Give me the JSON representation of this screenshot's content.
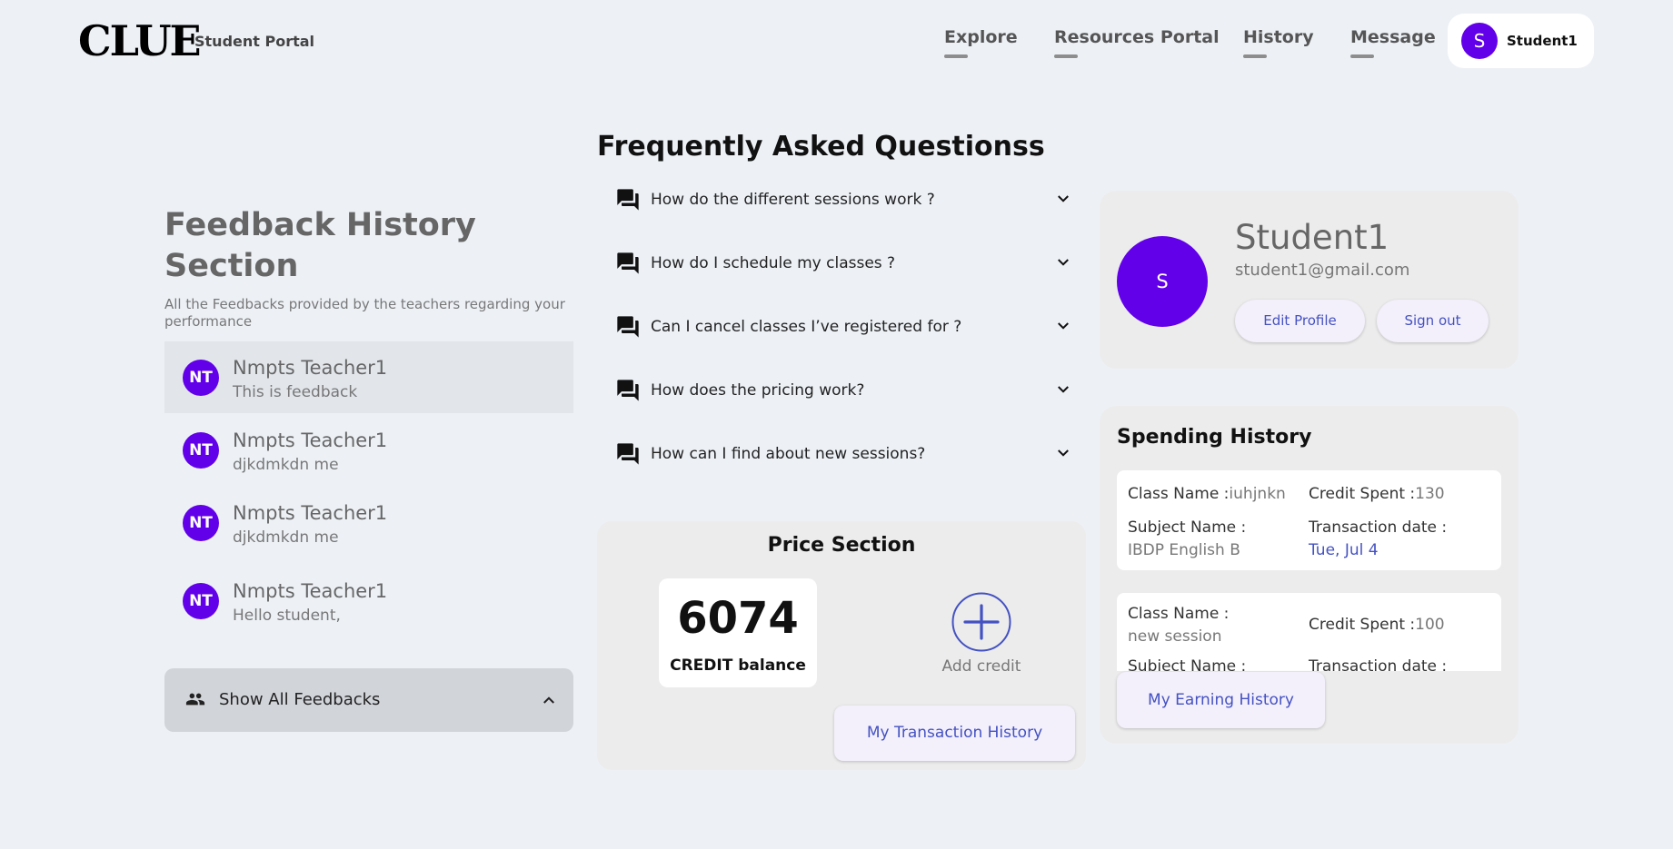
{
  "header": {
    "logo": "CLUE",
    "logo_sub": "Student Portal",
    "nav": [
      {
        "label": "Explore"
      },
      {
        "label": "Resources Portal"
      },
      {
        "label": "History"
      },
      {
        "label": "Message"
      }
    ],
    "user": {
      "initial": "S",
      "name": "Student1"
    }
  },
  "feedback": {
    "title": "Feedback History Section",
    "description": "All the Feedbacks provided by the teachers regarding your performance",
    "items": [
      {
        "initials": "NT",
        "name": "Nmpts Teacher1",
        "text": "This is feedback",
        "active": true
      },
      {
        "initials": "NT",
        "name": "Nmpts Teacher1",
        "text": "djkdmkdn me",
        "active": false
      },
      {
        "initials": "NT",
        "name": "Nmpts Teacher1",
        "text": "djkdmkdn me",
        "active": false
      },
      {
        "initials": "NT",
        "name": "Nmpts Teacher1",
        "text": "Hello student,",
        "active": false
      }
    ],
    "show_all_label": "Show All Feedbacks"
  },
  "faq": {
    "title": "Frequently Asked Questionss",
    "questions": [
      "How do the different sessions work ?",
      "How do I schedule my classes ?",
      "Can I cancel classes I’ve registered for ?",
      "How does the pricing work?",
      "How can I find about new sessions?"
    ]
  },
  "price": {
    "title": "Price Section",
    "balance": "6074",
    "balance_label": "CREDIT balance",
    "add_label": "Add credit",
    "transaction_button": "My Transaction History"
  },
  "profile": {
    "initial": "S",
    "name": "Student1",
    "email": "student1@gmail.com",
    "edit_label": "Edit Profile",
    "signout_label": "Sign out"
  },
  "spending": {
    "title": "Spending History",
    "class_name_label": "Class Name :",
    "subject_name_label": "Subject Name :",
    "credit_spent_label": "Credit Spent :",
    "transaction_date_label": "Transaction date :",
    "entries": [
      {
        "class_name": "iuhjnkn",
        "subject_name": "IBDP English B",
        "credit_spent": "130",
        "transaction_date": "Tue, Jul 4"
      },
      {
        "class_name": "new session",
        "subject_name": "",
        "credit_spent": "100",
        "transaction_date": ""
      }
    ],
    "earning_button": "My Earning History"
  },
  "colors": {
    "background": "#edf1f6",
    "avatar": "#6200ea",
    "link_blue": "#4452c2",
    "button_bg": "#f3effb",
    "card_bg": "#ececec"
  },
  "icons": {
    "faq": "question-answer-icon",
    "expand": "chevron-down-icon",
    "collapse": "chevron-up-icon",
    "people": "people-icon",
    "add": "add-circle-icon"
  }
}
